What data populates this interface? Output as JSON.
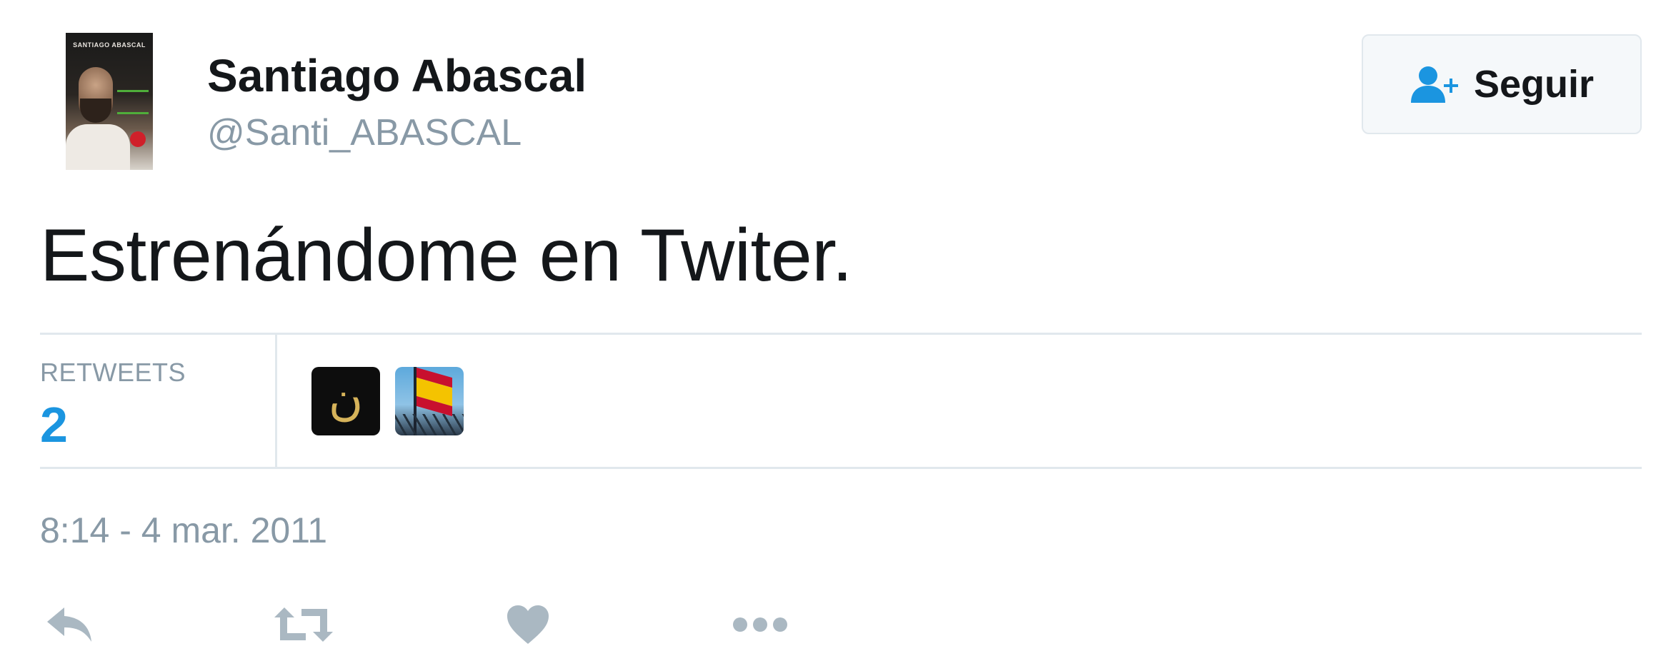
{
  "user": {
    "name": "Santiago Abascal",
    "handle": "@Santi_ABASCAL",
    "avatar_caption": "SANTIAGO ABASCAL"
  },
  "follow_button": {
    "label": "Seguir",
    "icon": "user-add-icon"
  },
  "tweet": {
    "text": "Estrenándome en Twiter."
  },
  "stats": {
    "retweets_label": "RETWEETS",
    "retweets_count": "2"
  },
  "retweeters": [
    {
      "icon": "nun-symbol-avatar",
      "glyph": "ن"
    },
    {
      "icon": "spanish-flag-avatar"
    }
  ],
  "timestamp": "8:14 - 4 mar. 2011",
  "actions": [
    "reply-icon",
    "retweet-icon",
    "like-icon",
    "more-icon"
  ],
  "colors": {
    "accent": "#1b95e0",
    "muted": "#8899a6",
    "text": "#14171a",
    "border": "#e1e8ed"
  }
}
